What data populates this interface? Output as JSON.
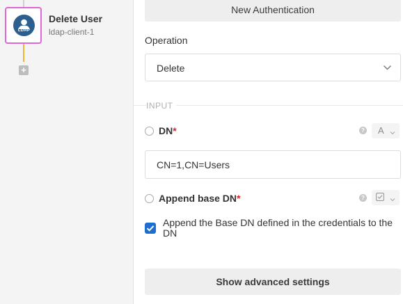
{
  "node": {
    "title": "Delete User",
    "subtitle": "ldap-client-1",
    "icon_text": "LDAP",
    "icon_name": "ldap-user-icon",
    "add_symbol": "+"
  },
  "auth": {
    "button_label": "New Authentication"
  },
  "operation": {
    "label": "Operation",
    "value": "Delete"
  },
  "section": {
    "title": "INPUT"
  },
  "fields": {
    "dn": {
      "label": "DN",
      "required_mark": "*",
      "type_label": "A",
      "value": "CN=1,CN=Users"
    },
    "append_base_dn": {
      "label": "Append base DN",
      "required_mark": "*",
      "checked": true,
      "checkbox_label": "Append the Base DN defined in the credentials to the DN"
    }
  },
  "help_symbol": "?",
  "advanced": {
    "button_label": "Show advanced settings"
  },
  "colors": {
    "node_border": "#e066d6",
    "connector": "#f0b232",
    "node_icon_bg": "#2c5f8f",
    "checkbox": "#1c6fd1",
    "required": "#d8232a"
  }
}
